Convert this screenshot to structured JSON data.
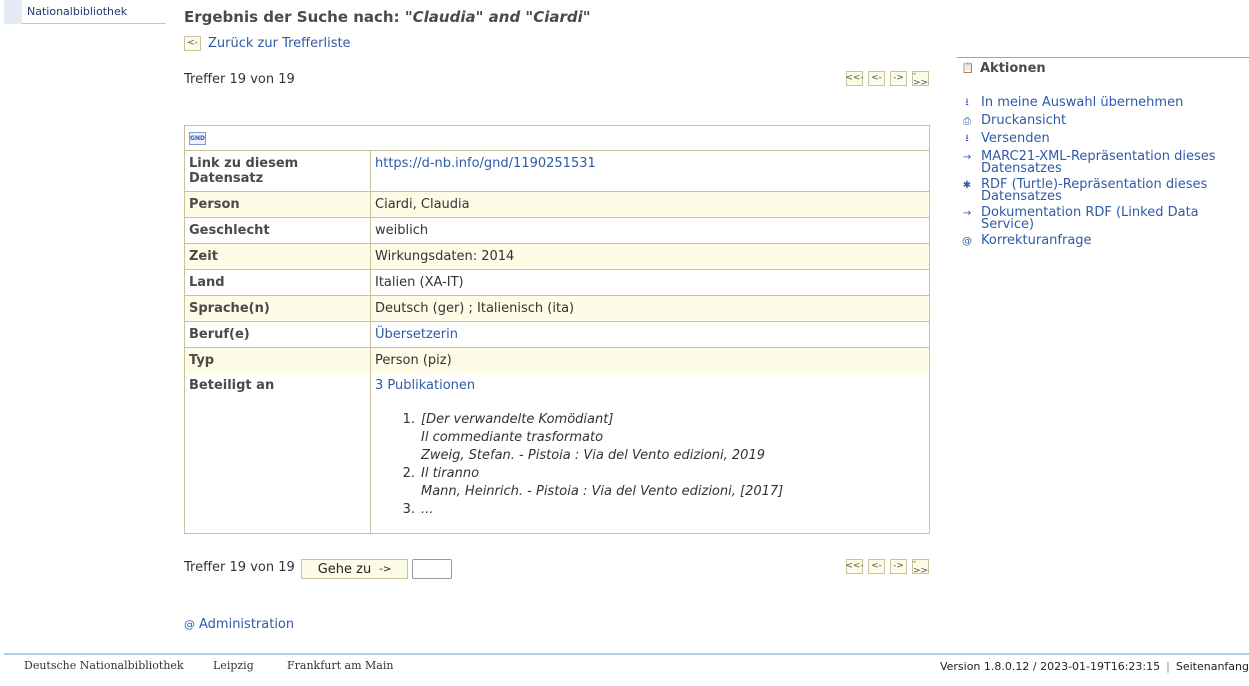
{
  "nav": {
    "item": "Nationalbibliothek"
  },
  "title": {
    "prefix": "Ergebnis der Suche nach: ",
    "query": "\"Claudia\" and \"Ciardi\""
  },
  "back_label": "Zurück zur Trefferliste",
  "hits_top": "Treffer 19 von 19",
  "hits_bottom": "Treffer 19 von 19",
  "record": {
    "rows": [
      {
        "key": "Link zu diesem Datensatz",
        "value": "https://d-nb.info/gnd/1190251531",
        "link": true
      },
      {
        "key": "Person",
        "value": "Ciardi, Claudia"
      },
      {
        "key": "Geschlecht",
        "value": "weiblich"
      },
      {
        "key": "Zeit",
        "value": "Wirkungsdaten: 2014"
      },
      {
        "key": "Land",
        "value": "Italien (XA-IT)"
      },
      {
        "key": "Sprache(n)",
        "value": "Deutsch (ger) ; Italienisch (ita)"
      },
      {
        "key": "Beruf(e)",
        "value": "Übersetzerin",
        "link": true
      },
      {
        "key": "Typ",
        "value": "Person (piz)"
      }
    ],
    "involved": {
      "key": "Beteiligt an",
      "link": "3 Publikationen",
      "items": [
        {
          "num": "1.",
          "lines": [
            "[Der verwandelte Komödiant]",
            "Il commediante trasformato",
            "Zweig, Stefan. - Pistoia : Via del Vento edizioni, 2019"
          ]
        },
        {
          "num": "2.",
          "lines": [
            "Il tiranno",
            "Mann, Heinrich. - Pistoia : Via del Vento edizioni, [2017]"
          ]
        },
        {
          "num": "3.",
          "lines": [
            "..."
          ]
        }
      ]
    }
  },
  "goto_label": "Gehe zu",
  "admin_label": "Administration",
  "aside": {
    "heading": "Aktionen",
    "actions": [
      {
        "icon": "download-icon",
        "label": "In meine Auswahl übernehmen"
      },
      {
        "icon": "print-icon",
        "label": "Druckansicht"
      },
      {
        "icon": "send-icon",
        "label": "Versenden"
      },
      {
        "icon": "arrow-right-icon",
        "label": "MARC21-XML-Repräsentation dieses Datensatzes"
      },
      {
        "icon": "rdf-icon",
        "label": "RDF (Turtle)-Repräsentation dieses Datensatzes"
      },
      {
        "icon": "arrow-right-icon",
        "label": "Dokumentation RDF (Linked Data Service)"
      },
      {
        "icon": "at-icon",
        "label": "Korrekturanfrage"
      }
    ]
  },
  "footer": {
    "links": [
      "Deutsche Nationalbibliothek",
      "Leipzig",
      "Frankfurt am Main"
    ],
    "version": "Version 1.8.0.12 / 2023-01-19T16:23:15",
    "top_link": "Seitenanfang"
  }
}
